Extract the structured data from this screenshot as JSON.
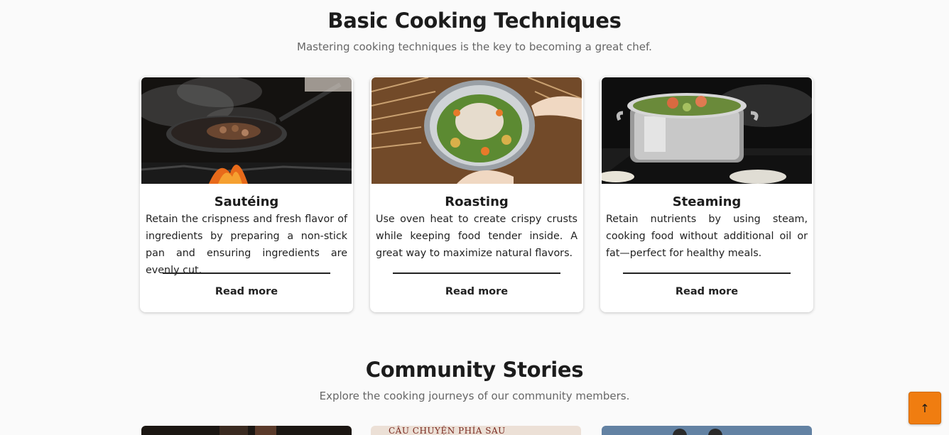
{
  "techniques": {
    "title": "Basic Cooking Techniques",
    "subtitle": "Mastering cooking techniques is the key to becoming a great chef.",
    "cards": [
      {
        "title": "Sautéing",
        "description": "Retain the crispness and fresh flavor of ingredients by preparing a non-stick pan and ensuring ingredients are evenly cut.",
        "link": "Read more"
      },
      {
        "title": "Roasting",
        "description": "Use oven heat to create crispy crusts while keeping food tender inside. A great way to maximize natural flavors.",
        "link": "Read more"
      },
      {
        "title": "Steaming",
        "description": "Retain nutrients by using steam, cooking food without additional oil or fat—perfect for healthy meals.",
        "link": "Read more"
      }
    ]
  },
  "community": {
    "title": "Community Stories",
    "subtitle": "Explore the cooking journeys of our community members.",
    "story_image_text": "CÂU CHUYỆN PHÍA SAU"
  },
  "back_to_top": {
    "icon": "arrow-up-icon",
    "symbol": "↑"
  },
  "colors": {
    "accent": "#f07d10",
    "background": "#fafafa"
  }
}
